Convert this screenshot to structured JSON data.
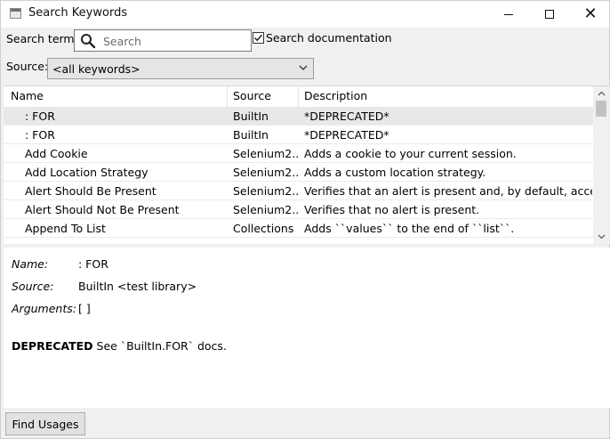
{
  "window": {
    "title": "Search Keywords"
  },
  "search": {
    "label": "Search term:",
    "placeholder": "Search",
    "value": ""
  },
  "search_documentation": {
    "label": "Search documentation",
    "checked": true
  },
  "source": {
    "label": "Source:",
    "selected": "<all keywords>"
  },
  "table": {
    "columns": [
      "Name",
      "Source",
      "Description"
    ],
    "rows": [
      {
        "name": ": FOR",
        "source": "BuiltIn",
        "description": "*DEPRECATED*",
        "selected": true
      },
      {
        "name": ": FOR",
        "source": "BuiltIn",
        "description": "*DEPRECATED*"
      },
      {
        "name": "Add Cookie",
        "source": "Selenium2...",
        "description": "Adds a cookie to your current session."
      },
      {
        "name": "Add Location Strategy",
        "source": "Selenium2...",
        "description": "Adds a custom location strategy."
      },
      {
        "name": "Alert Should Be Present",
        "source": "Selenium2...",
        "description": "Verifies that an alert is present and, by default, accep..."
      },
      {
        "name": "Alert Should Not Be Present",
        "source": "Selenium2...",
        "description": "Verifies that no alert is present."
      },
      {
        "name": "Append To List",
        "source": "Collections",
        "description": "Adds ``values`` to the end of ``list``."
      }
    ]
  },
  "details": {
    "name_label": "Name:",
    "name_value": ": FOR",
    "source_label": "Source:",
    "source_value": "BuiltIn <test library>",
    "arguments_label": "Arguments:",
    "arguments_value": "[ ]",
    "deprecated_bold": "DEPRECATED",
    "deprecated_text": " See `BuiltIn.FOR` docs."
  },
  "buttons": {
    "find_usages": "Find Usages"
  },
  "icons": {
    "app": "app-window-icon",
    "search": "search-icon",
    "checkbox": "check-icon",
    "dropdown": "chevron-down-icon",
    "minimize": "minimize-icon",
    "maximize": "maximize-icon",
    "close": "close-icon"
  },
  "colors": {
    "selected_row": "#e8e8e8",
    "window_bg": "#f0f0f0"
  }
}
